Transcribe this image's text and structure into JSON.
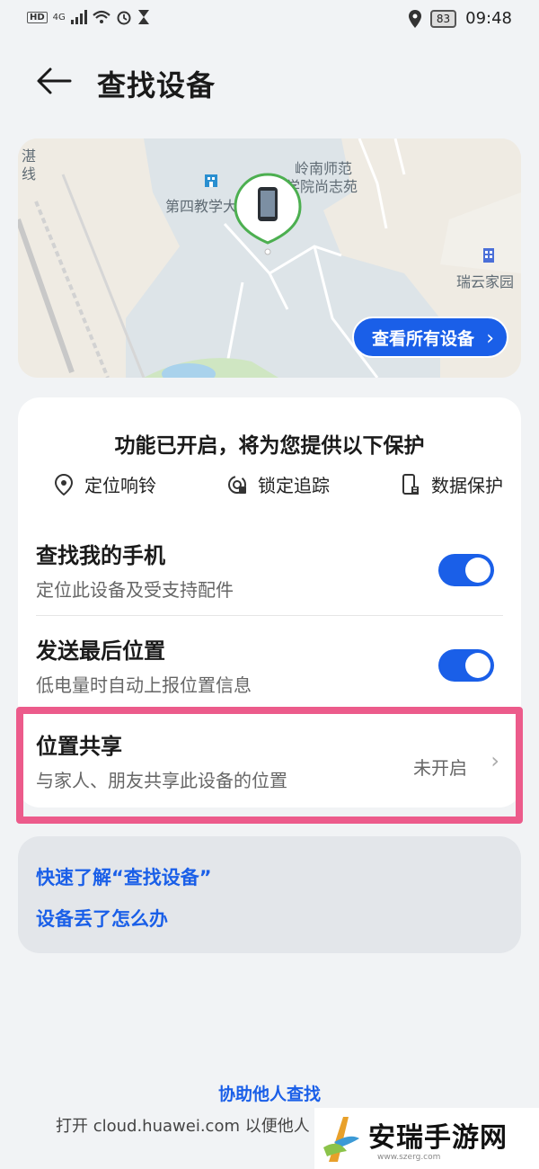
{
  "status_bar": {
    "hd_label": "HD",
    "signal_label": "4G",
    "battery": "83",
    "time": "09:48"
  },
  "header": {
    "title": "查找设备"
  },
  "map": {
    "labels": [
      "岭南师范",
      "学院尚志苑",
      "第四教学大",
      "瑞云家园",
      "湛",
      "线"
    ],
    "view_all_label": "查看所有设备"
  },
  "features": {
    "heading": "功能已开启，将为您提供以下保护",
    "items": [
      {
        "label": "定位响铃",
        "icon": "location-pin-icon"
      },
      {
        "label": "锁定追踪",
        "icon": "lock-track-icon"
      },
      {
        "label": "数据保护",
        "icon": "data-protect-icon"
      }
    ]
  },
  "settings": {
    "find_phone": {
      "title": "查找我的手机",
      "subtitle": "定位此设备及受支持配件",
      "enabled": true
    },
    "send_last": {
      "title": "发送最后位置",
      "subtitle": "低电量时自动上报位置信息",
      "enabled": true
    },
    "location_share": {
      "title": "位置共享",
      "subtitle": "与家人、朋友共享此设备的位置",
      "value": "未开启"
    }
  },
  "help": {
    "learn_link": "快速了解“查找设备”",
    "lost_link": "设备丢了怎么办"
  },
  "bottom": {
    "assist_link": "协助他人查找",
    "assist_text": "打开 cloud.huawei.com 以便他人"
  },
  "watermark": {
    "text": "安瑞手游网",
    "url": "www.szerg.com"
  },
  "colors": {
    "accent": "#1a5fe8",
    "highlight": "#ec5b8b",
    "background": "#f1f3f5"
  }
}
